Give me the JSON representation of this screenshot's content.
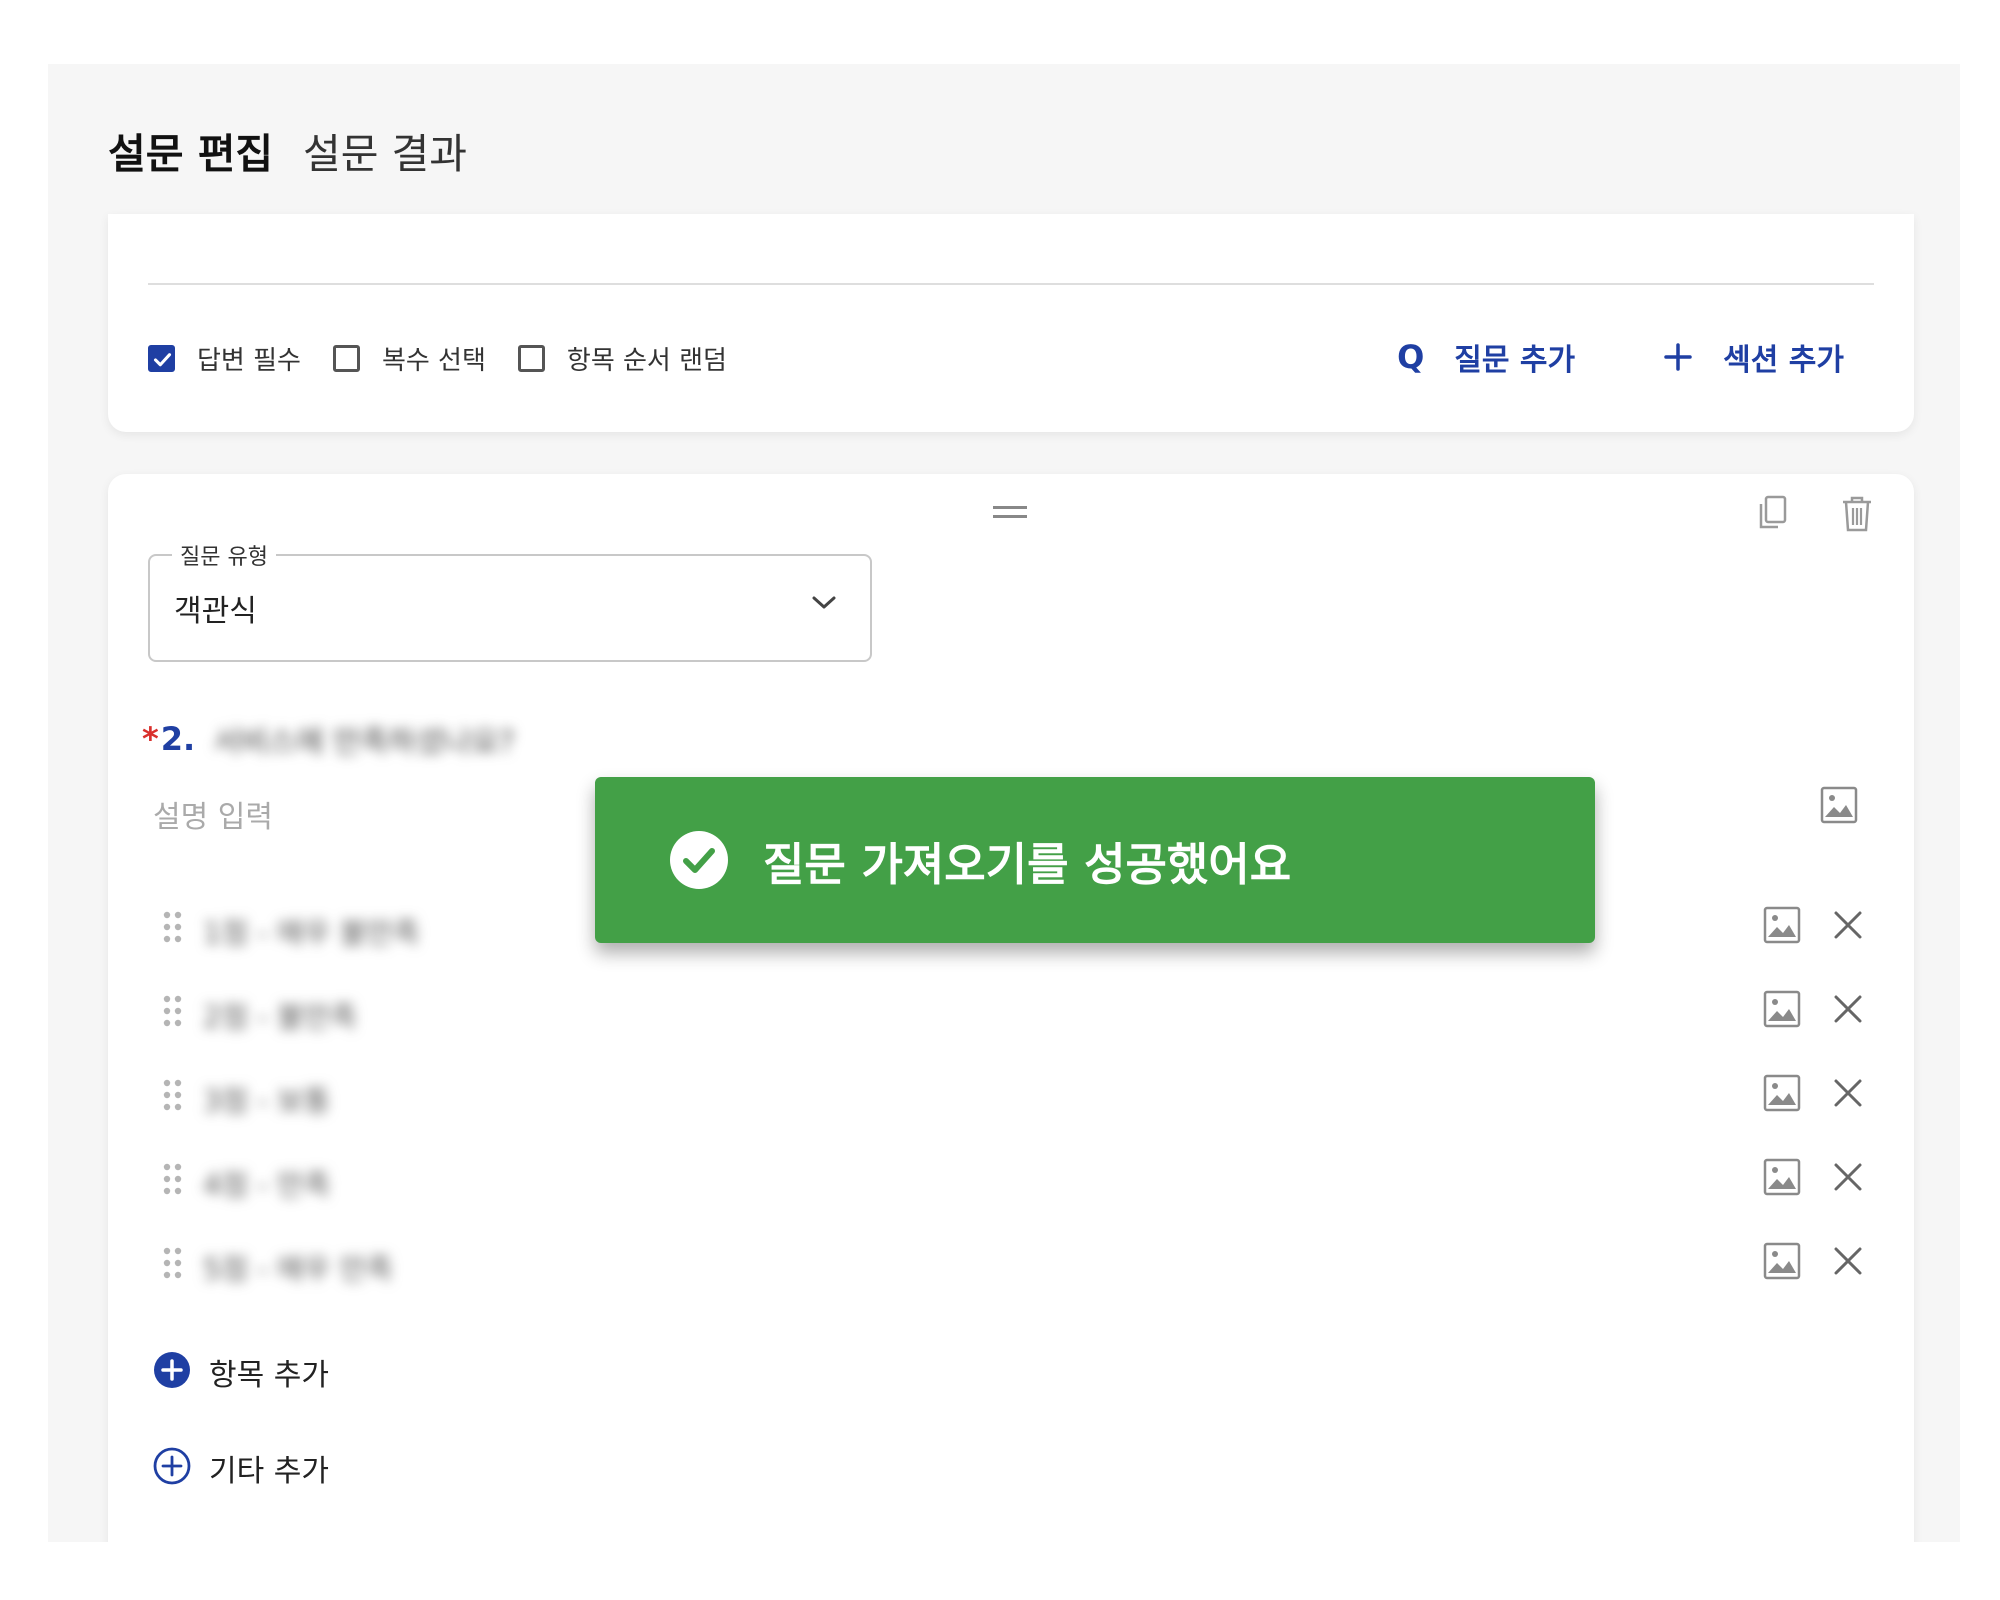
{
  "tabs": {
    "edit": "설문 편집",
    "results": "설문 결과"
  },
  "settings": {
    "required_label": "답변 필수",
    "required_checked": true,
    "multiple_label": "복수 선택",
    "multiple_checked": false,
    "random_label": "항목 순서 랜덤",
    "random_checked": false,
    "add_question_label": "질문 추가",
    "add_section_label": "섹션 추가"
  },
  "question": {
    "type_legend": "질문 유형",
    "type_value": "객관식",
    "required_marker": "*",
    "number": "2.",
    "title": "서비스에 만족하셨나요?",
    "description_placeholder": "설명 입력",
    "answers": [
      {
        "label": "1점 - 매우 불만족"
      },
      {
        "label": "2점 - 불만족"
      },
      {
        "label": "3점 - 보통"
      },
      {
        "label": "4점 - 만족"
      },
      {
        "label": "5점 - 매우 만족"
      }
    ],
    "add_item_label": "항목 추가",
    "add_other_label": "기타 추가"
  },
  "toast": {
    "message": "질문 가져오기를 성공했어요"
  },
  "colors": {
    "accent": "#1f3fa3",
    "required": "#d9302c",
    "toast_bg": "#43a047"
  }
}
